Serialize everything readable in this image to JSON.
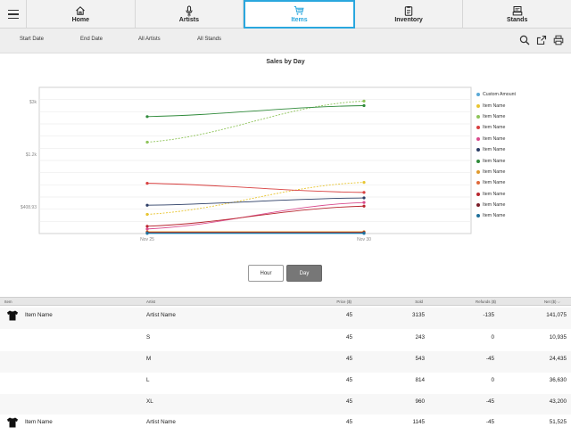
{
  "nav": {
    "tabs": [
      {
        "label": "Home",
        "icon": "home-icon"
      },
      {
        "label": "Artists",
        "icon": "microphone-icon"
      },
      {
        "label": "Items",
        "icon": "shopping-cart-icon",
        "active": true
      },
      {
        "label": "Inventory",
        "icon": "clipboard-icon"
      },
      {
        "label": "Stands",
        "icon": "register-icon"
      }
    ],
    "accent": "#2aa7de"
  },
  "filters": {
    "start_date": "Start Date",
    "end_date": "End Date",
    "artists": "All Artists",
    "stands": "All Stands"
  },
  "toolbar": [
    "search-icon",
    "export-icon",
    "print-icon"
  ],
  "chart_data": {
    "type": "line",
    "title": "Sales by Day",
    "x": [
      "Nov 25",
      "Nov 30"
    ],
    "y_ticks": [
      "$3k",
      "$1.2k",
      "$408.93"
    ],
    "series": [
      {
        "name": "Custom Amount",
        "color": "#5aa9d6",
        "values": [
          0,
          0
        ]
      },
      {
        "name": "Item Name",
        "color": "#e8c531",
        "values": [
          0.21,
          0.56
        ]
      },
      {
        "name": "Item Name",
        "color": "#8fc45a",
        "values": [
          1.0,
          1.45
        ]
      },
      {
        "name": "Item Name",
        "color": "#d84040",
        "values": [
          0.55,
          0.45
        ]
      },
      {
        "name": "Item Name",
        "color": "#d94a8c",
        "values": [
          0.05,
          0.34
        ]
      },
      {
        "name": "Item Name",
        "color": "#2c3e66",
        "values": [
          0.31,
          0.39
        ]
      },
      {
        "name": "Item Name",
        "color": "#2f8a3a",
        "values": [
          1.28,
          1.4
        ]
      },
      {
        "name": "Item Name",
        "color": "#e09a2d",
        "values": [
          0.02,
          0.02
        ]
      },
      {
        "name": "Item Name",
        "color": "#e06a3a",
        "values": [
          0.015,
          0.015
        ]
      },
      {
        "name": "Item Name",
        "color": "#b8252e",
        "values": [
          0.08,
          0.3
        ]
      },
      {
        "name": "Item Name",
        "color": "#7a1d28",
        "values": [
          0.01,
          0.01
        ]
      },
      {
        "name": "Item Name",
        "color": "#1f6f9a",
        "values": [
          0.005,
          0.005
        ]
      }
    ]
  },
  "segment": {
    "hour": "Hour",
    "day": "Day"
  },
  "table": {
    "headers": [
      "Item",
      "Artist",
      "Price ($)",
      "Sold",
      "Refunds ($)",
      "Net ($)"
    ],
    "rows": [
      {
        "item": "Item Name",
        "artist": "Artist Name",
        "price": "45",
        "sold": "3135",
        "refunds": "-135",
        "net": "141,075",
        "shirt": true
      },
      {
        "item": "",
        "artist": "S",
        "price": "45",
        "sold": "243",
        "refunds": "0",
        "net": "10,935",
        "shirt": false
      },
      {
        "item": "",
        "artist": "M",
        "price": "45",
        "sold": "543",
        "refunds": "-45",
        "net": "24,435",
        "shirt": false
      },
      {
        "item": "",
        "artist": "L",
        "price": "45",
        "sold": "814",
        "refunds": "0",
        "net": "36,630",
        "shirt": false
      },
      {
        "item": "",
        "artist": "XL",
        "price": "45",
        "sold": "960",
        "refunds": "-45",
        "net": "43,200",
        "shirt": false
      },
      {
        "item": "Item Name",
        "artist": "Artist Name",
        "price": "45",
        "sold": "1145",
        "refunds": "-45",
        "net": "51,525",
        "shirt": true
      }
    ]
  }
}
